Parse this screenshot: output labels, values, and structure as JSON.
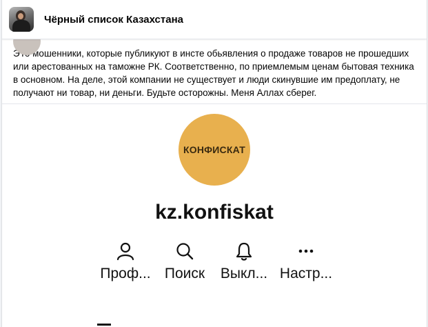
{
  "group": {
    "title": "Чёрный список Казахстана",
    "avatar_icon": "person-photo-icon"
  },
  "post": {
    "text": "ЭТо мошенники, которые публикуют в инсте обьявления о продаже товаров не прошедших или арестованных на таможне РК. Соответственно, по приемлемым ценам бытовая техника в основном. На деле, этой компании не существует и люди скинувшие им предоплату, не получают ни товар, ни деньги. Будьте осторожны. Меня Аллах сберег."
  },
  "embed": {
    "logo_text": "КОНФИСКАТ",
    "logo_color": "#e8b04e",
    "username": "kz.konfiskat",
    "actions": [
      {
        "label": "Проф...",
        "icon": "person-icon"
      },
      {
        "label": "Поиск",
        "icon": "search-icon"
      },
      {
        "label": "Выкл...",
        "icon": "bell-icon"
      },
      {
        "label": "Настр...",
        "icon": "more-dots-icon"
      }
    ]
  }
}
